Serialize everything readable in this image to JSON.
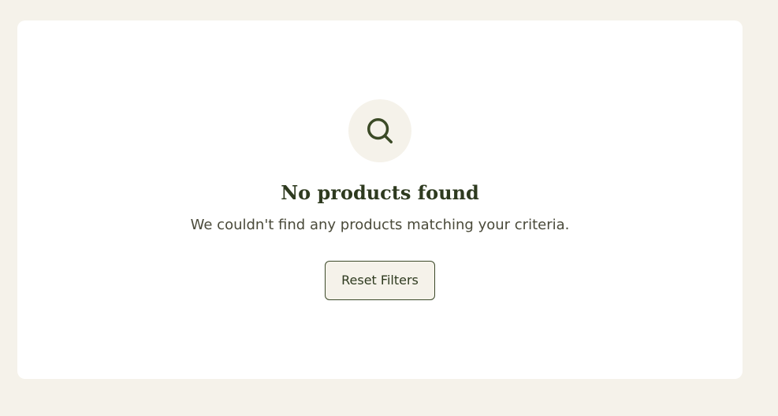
{
  "empty_state": {
    "icon": "search-icon",
    "title": "No products found",
    "message": "We couldn't find any products matching your criteria.",
    "reset_label": "Reset Filters"
  },
  "colors": {
    "page_background": "#f5f2ea",
    "card_background": "#ffffff",
    "accent_dark_green": "#2e3a1f",
    "icon_circle_background": "#f5f2ea"
  }
}
